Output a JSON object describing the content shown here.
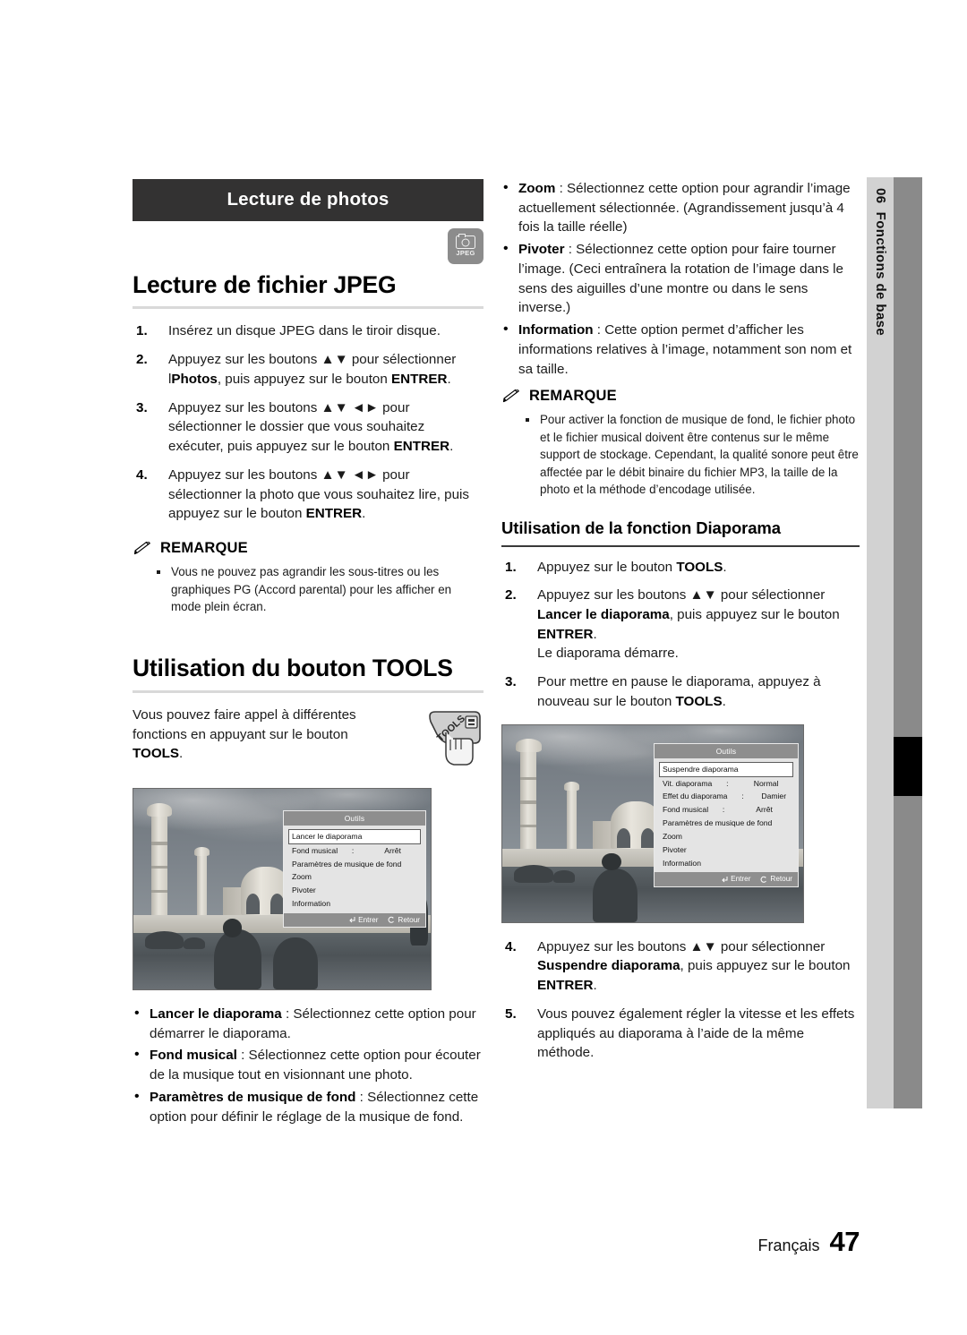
{
  "section_bar": {
    "title": "Lecture de photos"
  },
  "media_badge": {
    "label": "JPEG",
    "icon": "camera-icon"
  },
  "left_column": {
    "heading": "Lecture de fichier JPEG",
    "steps": [
      {
        "num": "1.",
        "html": "Insérez un disque JPEG dans le tiroir disque."
      },
      {
        "num": "2.",
        "html": "Appuyez sur les boutons ▲▼ pour sélectionner l<b>Photos</b>, puis appuyez sur le bouton <b>ENTRER</b>."
      },
      {
        "num": "3.",
        "html": "Appuyez sur les boutons ▲▼ ◄► pour sélectionner le dossier que vous souhaitez exécuter, puis appuyez sur le bouton <b>ENTRER</b>."
      },
      {
        "num": "4.",
        "html": "Appuyez sur les boutons ▲▼ ◄► pour sélectionner la photo que vous souhaitez lire, puis appuyez sur le bouton <b>ENTRER</b>."
      }
    ],
    "remarque": {
      "label": "REMARQUE",
      "icon": "pencil-icon",
      "notes": [
        "Vous ne pouvez pas agrandir les sous-titres ou les graphiques PG (Accord parental) pour les afficher en mode plein écran."
      ]
    },
    "tools_heading": "Utilisation du bouton TOOLS",
    "tools_intro_html": "Vous pouvez faire appel à différentes fonctions en appuyant sur le bouton <b>TOOLS</b>.",
    "tools_illustration": "hand-pressing-tools-button-icon",
    "definitions": [
      {
        "term": "Lancer le diaporama",
        "text": " : Sélectionnez cette option pour démarrer le diaporama."
      },
      {
        "term": "Fond musical",
        "text": " : Sélectionnez cette option pour écouter de la musique tout en visionnant une photo."
      },
      {
        "term": "Paramètres de musique de fond",
        "text": " : Sélectionnez cette option pour définir le réglage de la musique de fond."
      }
    ]
  },
  "right_column": {
    "definitions": [
      {
        "term": "Zoom",
        "text": " : Sélectionnez cette option pour agrandir l’image actuellement sélectionnée. (Agrandissement jusqu’à 4 fois la taille réelle)"
      },
      {
        "term": "Pivoter",
        "text": " : Sélectionnez cette option pour faire tourner l’image. (Ceci entraînera la rotation de l’image dans le sens des aiguilles d’une montre ou dans le sens inverse.)"
      },
      {
        "term": "Information",
        "text": " : Cette option permet d’afficher les informations relatives à l’image, notamment son nom et sa taille."
      }
    ],
    "remarque": {
      "label": "REMARQUE",
      "icon": "pencil-icon",
      "notes": [
        "Pour activer la fonction de musique de fond, le fichier photo et le fichier musical doivent être contenus sur le même support de stockage. Cependant, la qualité sonore peut être affectée par le débit binaire du fichier MP3, la taille de la photo et la méthode d’encodage utilisée."
      ]
    },
    "slideshow_heading": "Utilisation de la fonction Diaporama",
    "steps": [
      {
        "num": "1.",
        "html": "Appuyez sur le bouton <b>TOOLS</b>."
      },
      {
        "num": "2.",
        "html": "Appuyez sur les boutons ▲▼ pour sélectionner <b>Lancer le diaporama</b>, puis appuyez sur le bouton <b>ENTRER</b>.<br>Le diaporama démarre."
      },
      {
        "num": "3.",
        "html": "Pour mettre en pause le diaporama, appuyez à nouveau sur le bouton <b>TOOLS</b>."
      }
    ],
    "steps_after": [
      {
        "num": "4.",
        "html": "Appuyez sur les boutons ▲▼ pour sélectionner <b>Suspendre diaporama</b>, puis appuyez sur le bouton <b>ENTRER</b>."
      },
      {
        "num": "5.",
        "html": "Vous pouvez également régler la vitesse et les effets appliqués au diaporama à l’aide de la même méthode."
      }
    ]
  },
  "osd_menu_1": {
    "title": "Outils",
    "items": [
      {
        "label": "Lancer le diaporama",
        "selected": true
      },
      {
        "label": "Fond musical",
        "sep": ":",
        "value": "Arrêt"
      },
      {
        "label": "Paramètres de musique de fond"
      },
      {
        "label": "Zoom"
      },
      {
        "label": "Pivoter"
      },
      {
        "label": "Information"
      }
    ],
    "footer": {
      "enter": "Entrer",
      "return": "Retour"
    }
  },
  "osd_menu_2": {
    "title": "Outils",
    "items": [
      {
        "label": "Suspendre diaporama",
        "selected": true
      },
      {
        "label": "Vit. diaporama",
        "sep": ":",
        "value": "Normal"
      },
      {
        "label": "Effet du diaporama",
        "sep": ":",
        "value": "Damier"
      },
      {
        "label": "Fond musical",
        "sep": ":",
        "value": "Arrêt"
      },
      {
        "label": "Paramètres de musique de fond"
      },
      {
        "label": "Zoom"
      },
      {
        "label": "Pivoter"
      },
      {
        "label": "Information"
      }
    ],
    "footer": {
      "enter": "Entrer",
      "return": "Retour"
    }
  },
  "side_tab": {
    "number": "06",
    "label": "Fonctions de base"
  },
  "footer": {
    "language": "Français",
    "page": "47"
  },
  "colors": {
    "section_bar_bg": "#333232",
    "badge_bg": "#8c8c8c",
    "rule": "#d9d9d9",
    "tab_light": "#d2d2d2",
    "tab_dark": "#8a8a8a",
    "osd_header": "#8e8e8e",
    "osd_body": "#e4e4e4"
  }
}
